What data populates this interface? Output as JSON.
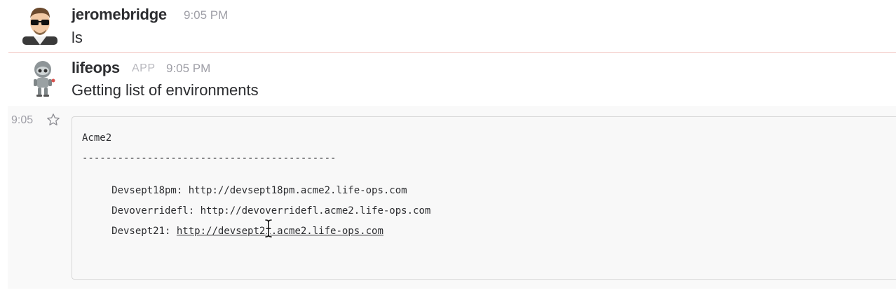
{
  "messages": [
    {
      "author": "jeromebridge",
      "time": "9:05 PM",
      "text": "ls"
    },
    {
      "author": "lifeops",
      "badge": "APP",
      "time": "9:05 PM",
      "text": "Getting list of environments"
    }
  ],
  "attachment": {
    "side_time": "9:05",
    "code": {
      "header": "Acme2",
      "rule": "-------------------------------------------",
      "lines": [
        {
          "label": " Devsept18pm: ",
          "url": "http://devsept18pm.acme2.life-ops.com"
        },
        {
          "label": " Devoverridefl: ",
          "url": "http://devoverridefl.acme2.life-ops.com"
        },
        {
          "label": " Devsept21: ",
          "url": "http://devsept21.acme2.life-ops.com"
        }
      ]
    }
  },
  "icons": {
    "avatar_1": "person-with-glasses-avatar",
    "avatar_2": "robot-avatar",
    "star": "star-icon",
    "cursor": "text-cursor-icon"
  },
  "colors": {
    "divider": "#f2c4c0",
    "timestamp": "#9e9ea6",
    "code_bg": "#f8f8f8"
  }
}
